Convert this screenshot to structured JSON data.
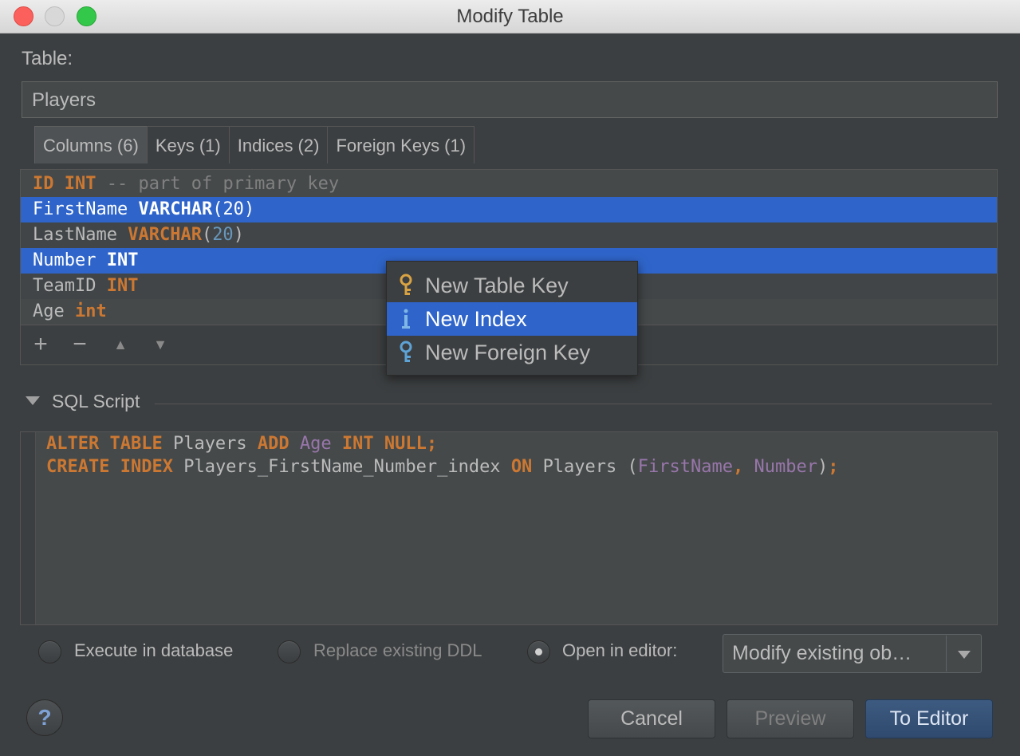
{
  "window": {
    "title": "Modify Table"
  },
  "table": {
    "label": "Table:",
    "name": "Players"
  },
  "tabs": [
    {
      "label": "Columns (6)",
      "active": true
    },
    {
      "label": "Keys (1)"
    },
    {
      "label": "Indices (2)"
    },
    {
      "label": "Foreign Keys (1)"
    }
  ],
  "columns": [
    {
      "name": "ID",
      "type": "INT",
      "comment": "-- part of primary key"
    },
    {
      "name": "FirstName",
      "type": "VARCHAR",
      "args": "20",
      "selected": true
    },
    {
      "name": "LastName",
      "type": "VARCHAR",
      "args": "20"
    },
    {
      "name": "Number",
      "type": "INT",
      "selected": true
    },
    {
      "name": "TeamID",
      "type": "INT"
    },
    {
      "name": "Age",
      "type": "int"
    }
  ],
  "toolbar": {
    "add": "+",
    "remove": "−",
    "up": "▲",
    "down": "▼"
  },
  "popup": [
    {
      "label": "New Table Key",
      "icon": "key-icon"
    },
    {
      "label": "New Index",
      "icon": "index-icon",
      "selected": true
    },
    {
      "label": "New Foreign Key",
      "icon": "foreign-key-icon"
    }
  ],
  "sql": {
    "section_title": "SQL Script",
    "line1": {
      "k1": "ALTER TABLE",
      "t1": "Players",
      "k2": "ADD",
      "c1": "Age",
      "k3": "INT NULL;"
    },
    "line2": {
      "k1": "CREATE INDEX",
      "t1": "Players_FirstName_Number_index",
      "k2": "ON",
      "t2": "Players",
      "p1": "(",
      "c1": "FirstName",
      "k3": ",",
      "c2": "Number",
      "p2": ")",
      "k4": ";"
    }
  },
  "options": {
    "execute": "Execute in database",
    "replace": "Replace existing DDL",
    "open": "Open in editor:",
    "combo_value": "Modify existing ob…"
  },
  "buttons": {
    "help": "?",
    "cancel": "Cancel",
    "preview": "Preview",
    "to_editor": "To Editor"
  },
  "colors": {
    "background": "#3c3f41",
    "selection": "#2f65ca",
    "keyword": "#cc7832",
    "number": "#6897bb",
    "identifier": "#9876aa"
  }
}
